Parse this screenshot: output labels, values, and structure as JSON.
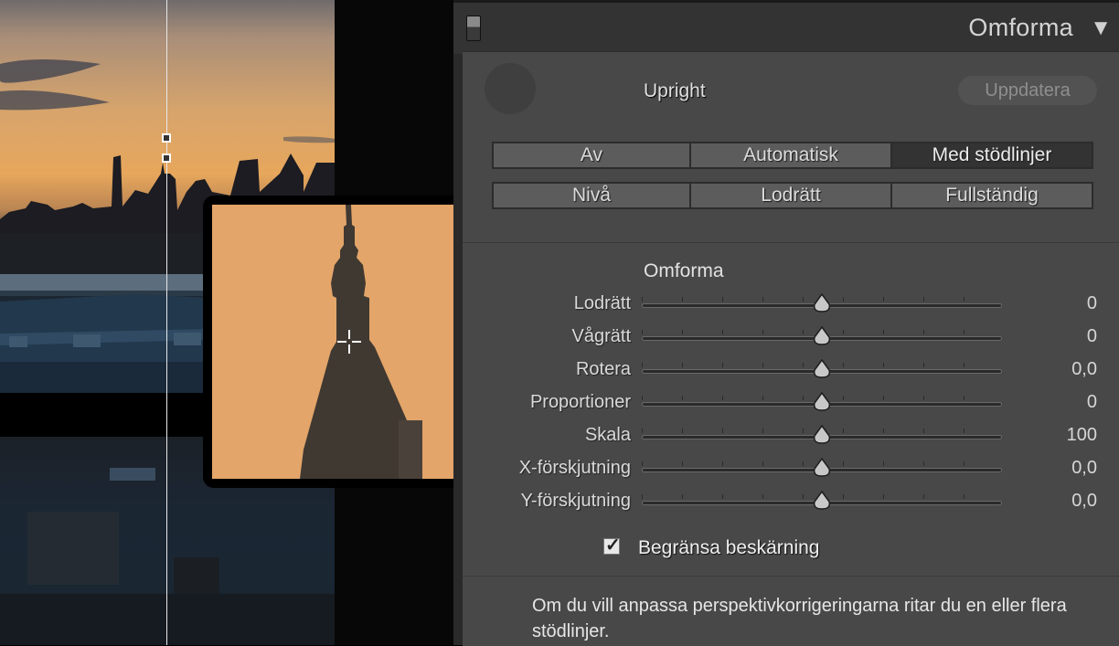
{
  "panel": {
    "title": "Omforma",
    "collapse_icon": "triangle-down-icon",
    "upright": {
      "label": "Upright",
      "update_button": "Uppdatera",
      "modes_row1": [
        "Av",
        "Automatisk",
        "Med stödlinjer"
      ],
      "modes_row2": [
        "Nivå",
        "Lodrätt",
        "Fullständig"
      ],
      "active_mode": "Med stödlinjer"
    },
    "transform": {
      "title": "Omforma",
      "sliders": [
        {
          "label": "Lodrätt",
          "value": "0"
        },
        {
          "label": "Vågrätt",
          "value": "0"
        },
        {
          "label": "Rotera",
          "value": "0,0"
        },
        {
          "label": "Proportioner",
          "value": "0"
        },
        {
          "label": "Skala",
          "value": "100"
        },
        {
          "label": "X-förskjutning",
          "value": "0,0"
        },
        {
          "label": "Y-förskjutning",
          "value": "0,0"
        }
      ]
    },
    "constrain_crop": {
      "label": "Begränsa beskärning",
      "checked": true
    },
    "hint": "Om du vill anpassa perspektivkorrigeringarna ritar du en eller flera stödlinjer."
  },
  "icons": {
    "loupe_cursor": "crosshair-icon",
    "check": "checkmark-icon"
  },
  "colors": {
    "panel_bg": "#484848",
    "header_bg": "#333333",
    "sky": "#e6a86a"
  }
}
